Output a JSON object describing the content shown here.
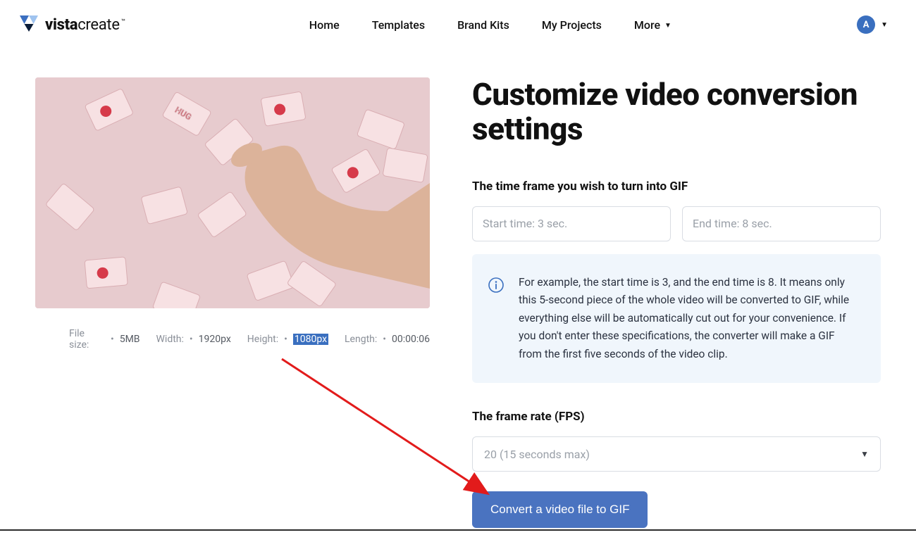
{
  "brand": {
    "bold": "vista",
    "light": "create",
    "tm": "™"
  },
  "nav": {
    "home": "Home",
    "templates": "Templates",
    "brandkits": "Brand Kits",
    "projects": "My Projects",
    "more": "More"
  },
  "user": {
    "initial": "A"
  },
  "preview": {
    "meta": {
      "filesize_label": "File size:",
      "filesize_value": "5MB",
      "width_label": "Width:",
      "width_value": "1920px",
      "height_label": "Height:",
      "height_value": "1080px",
      "length_label": "Length:",
      "length_value": "00:00:06"
    }
  },
  "heading": "Customize video conversion settings",
  "timeframe": {
    "label": "The time frame you wish to turn into GIF",
    "start_placeholder": "Start time: 3 sec.",
    "end_placeholder": "End time: 8 sec.",
    "info": "For example, the start time is 3, and the end time is 8. It means only this 5-second piece of the whole video will be converted to GIF, while everything else will be automatically cut out for your convenience. If you don't enter these specifications, the converter will make a GIF from the first five seconds of the video clip."
  },
  "fps": {
    "label": "The frame rate (FPS)",
    "selected": "20 (15 seconds max)"
  },
  "cta_label": "Convert a video file to GIF"
}
